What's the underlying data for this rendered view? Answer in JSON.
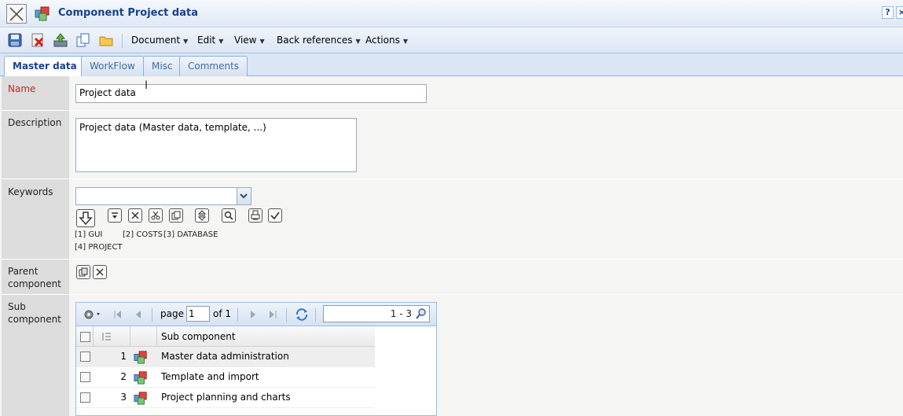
{
  "window": {
    "title": "Component Project data",
    "help_label": "?",
    "close_label": "×"
  },
  "toolbar": {
    "menus": [
      {
        "label": "Document"
      },
      {
        "label": "Edit"
      },
      {
        "label": "View"
      },
      {
        "label": "Back references"
      },
      {
        "label": "Actions"
      }
    ]
  },
  "tabs": [
    {
      "label": "Master data",
      "active": true
    },
    {
      "label": "WorkFlow",
      "active": false
    },
    {
      "label": "Misc",
      "active": false
    },
    {
      "label": "Comments",
      "active": false
    }
  ],
  "form": {
    "name_label": "Name",
    "name_value": "Project data",
    "description_label": "Description",
    "description_value": "Project data (Master data, template, ...)",
    "keywords_label": "Keywords",
    "keywords_value": "",
    "keyword_list": [
      "[1] GUI",
      "[2] COSTS",
      "[3] DATABASE",
      "[4] PROJECT"
    ],
    "parent_label_1": "Parent",
    "parent_label_2": "component",
    "sub_label_1": "Sub",
    "sub_label_2": "component"
  },
  "grid": {
    "page_label": "page",
    "page_value": "1",
    "of_label": "of 1",
    "range_label": "1 - 3",
    "column_header": "Sub component",
    "rows": [
      {
        "num": "1",
        "name": "Master data administration"
      },
      {
        "num": "2",
        "name": "Template and import"
      },
      {
        "num": "3",
        "name": "Project planning and charts"
      }
    ]
  },
  "colors": {
    "title_text": "#15428b",
    "required_label": "#c02525",
    "tab_border": "#8db2e3"
  }
}
